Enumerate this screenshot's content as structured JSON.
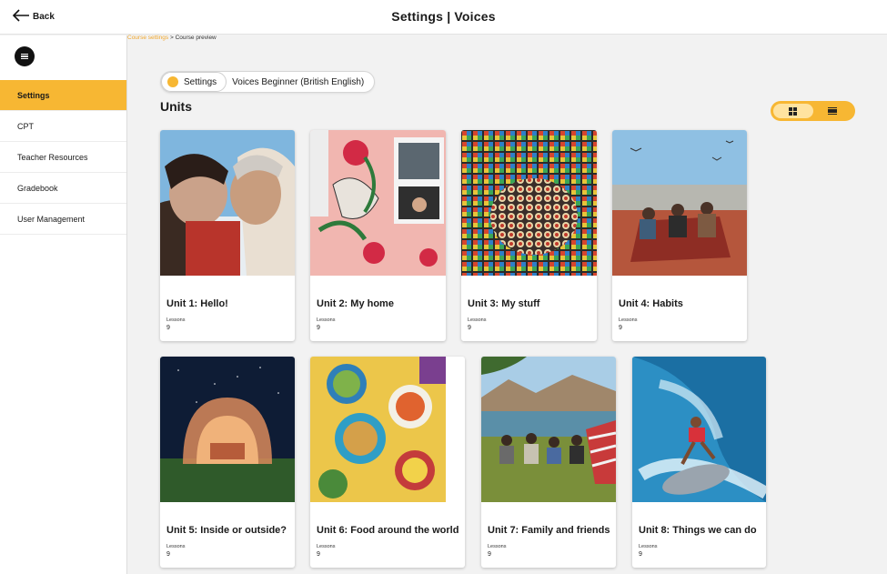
{
  "header": {
    "back_label": "Back",
    "title": "Settings | Voices"
  },
  "sidebar": {
    "items": [
      {
        "label": "Settings",
        "active": true
      },
      {
        "label": "CPT",
        "active": false
      },
      {
        "label": "Teacher Resources",
        "active": false
      },
      {
        "label": "Gradebook",
        "active": false
      },
      {
        "label": "User Management",
        "active": false
      }
    ]
  },
  "breadcrumb": {
    "link": "Course settings",
    "separator": " > ",
    "current": "Course preview"
  },
  "course_selector": {
    "settings_label": "Settings",
    "course_name": "Voices Beginner (British English)"
  },
  "units_heading": "Units",
  "view_toggle": {
    "selected": "grid",
    "options": [
      "grid-icon",
      "list-icon"
    ]
  },
  "colors": {
    "accent": "#f7b733",
    "background": "#f2f2f2"
  },
  "units": [
    {
      "title": "Unit 1: Hello!",
      "lessons_label": "Lessons",
      "lessons": "9",
      "image": "couple-nose-to-nose"
    },
    {
      "title": "Unit 2: My home",
      "lessons_label": "Lessons",
      "lessons": "9",
      "image": "floral-wall-window"
    },
    {
      "title": "Unit 3: My stuff",
      "lessons_label": "Lessons",
      "lessons": "9",
      "image": "collection-mosaic"
    },
    {
      "title": "Unit 4: Habits",
      "lessons_label": "Lessons",
      "lessons": "9",
      "image": "rooftop-picnic"
    },
    {
      "title": "Unit 5: Inside or outside?",
      "lessons_label": "Lessons",
      "lessons": "9",
      "image": "bubble-tent-night"
    },
    {
      "title": "Unit 6: Food around the world",
      "lessons_label": "Lessons",
      "lessons": "9",
      "image": "food-table"
    },
    {
      "title": "Unit 7: Family and friends",
      "lessons_label": "Lessons",
      "lessons": "9",
      "image": "family-picnic-lake"
    },
    {
      "title": "Unit 8: Things we can do",
      "lessons_label": "Lessons",
      "lessons": "9",
      "image": "surfer-wave"
    }
  ]
}
